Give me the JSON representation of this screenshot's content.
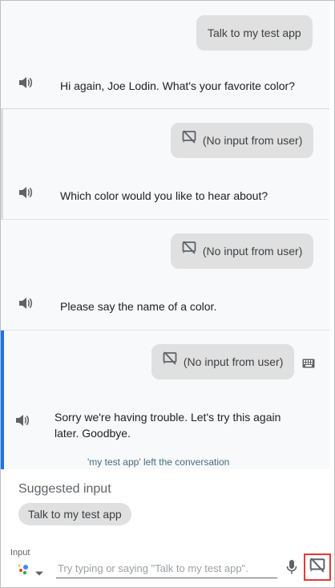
{
  "conversation": {
    "turn1": {
      "user": "Talk to my test app",
      "reply": "Hi again, Joe Lodin. What's your favorite color?"
    },
    "turn2": {
      "user": "(No input from user)",
      "reply": "Which color would you like to hear about?"
    },
    "turn3": {
      "user": "(No input from user)",
      "reply": "Please say the name of a color."
    },
    "turn4": {
      "user": "(No input from user)",
      "reply_line1": "Sorry we're having trouble. Let's try this again",
      "reply_line2": "later. Goodbye.",
      "left_note": "'my test app' left the conversation"
    }
  },
  "suggested": {
    "title": "Suggested input",
    "chips": [
      "Talk to my test app"
    ]
  },
  "input": {
    "label": "Input",
    "placeholder": "Try typing or saying \"Talk to my test app\".",
    "value": ""
  },
  "colors": {
    "accent": "#1a73e8",
    "highlight": "#e53935",
    "bubble": "#e0e0e0"
  },
  "icons": [
    "speaker-icon",
    "no-input-icon",
    "keyboard-icon",
    "assistant-icon",
    "chevron-down-icon",
    "mic-icon"
  ]
}
